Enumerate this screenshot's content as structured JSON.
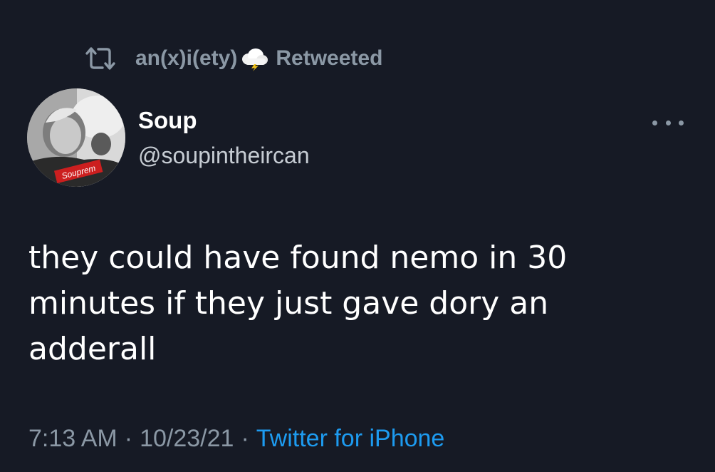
{
  "retweet": {
    "icon": "retweet-icon",
    "user": "an(x)i(ety)",
    "emoji": "cloud-lightning-icon",
    "suffix": "Retweeted"
  },
  "author": {
    "name": "Soup",
    "handle": "@soupintheircan",
    "avatar_label": "Souprem"
  },
  "tweet": {
    "lines": [
      "they could have found nemo in 30",
      "minutes if they just gave dory an",
      "adderall"
    ]
  },
  "footer": {
    "time": "7:13 AM",
    "separator": "·",
    "date": "10/23/21",
    "source": "Twitter for iPhone"
  },
  "colors": {
    "background": "#161a25",
    "text": "#ffffff",
    "muted": "#8b98a5",
    "link": "#1d9bf0"
  }
}
